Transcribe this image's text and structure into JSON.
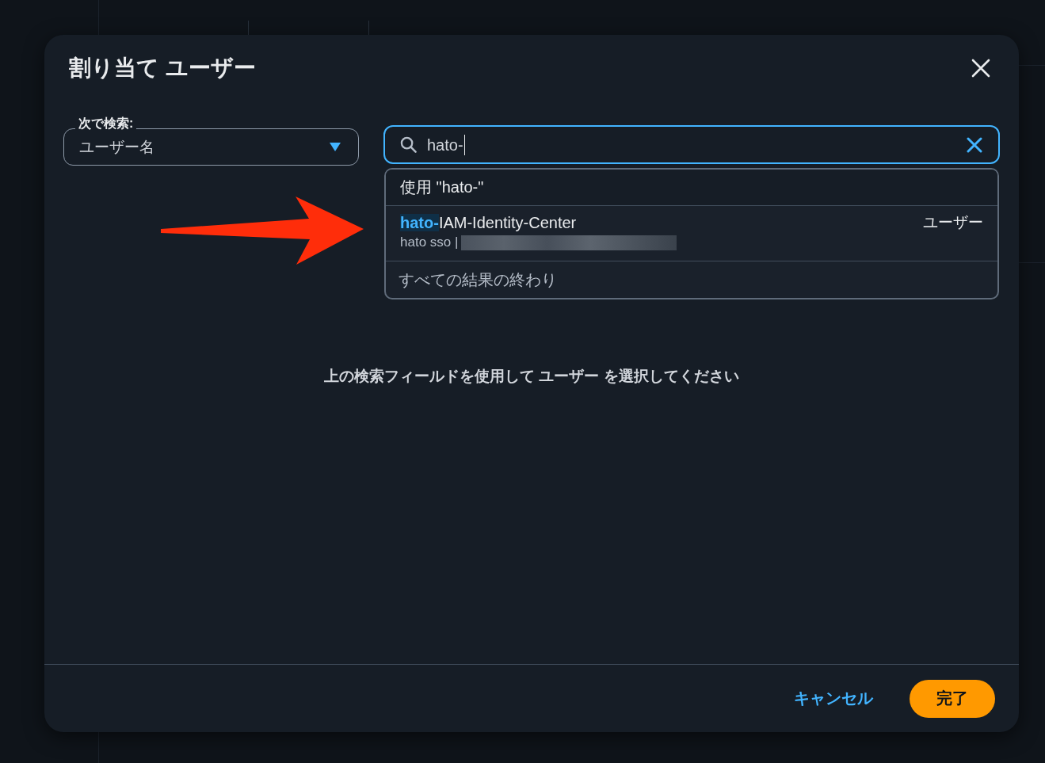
{
  "dialog": {
    "title": "割り当て ユーザー",
    "search_by": {
      "label": "次で検索:",
      "value": "ユーザー名"
    },
    "search": {
      "value": "hato-",
      "focused": true
    },
    "suggestions": [
      {
        "kind": "query",
        "label": "使用 \"hato-\""
      },
      {
        "kind": "result",
        "label": "**hato-**IAM-Identity-Center",
        "tag": "ユーザー",
        "description": "hato sso |",
        "redacted": true
      },
      {
        "kind": "end",
        "label": "すべての結果の終わり"
      }
    ],
    "empty_message": "上の検索フィールドを使用して ユーザー を選択してください",
    "buttons": [
      {
        "kind": "link",
        "label": "キャンセル"
      },
      {
        "kind": "primary",
        "label": "完了"
      }
    ]
  }
}
